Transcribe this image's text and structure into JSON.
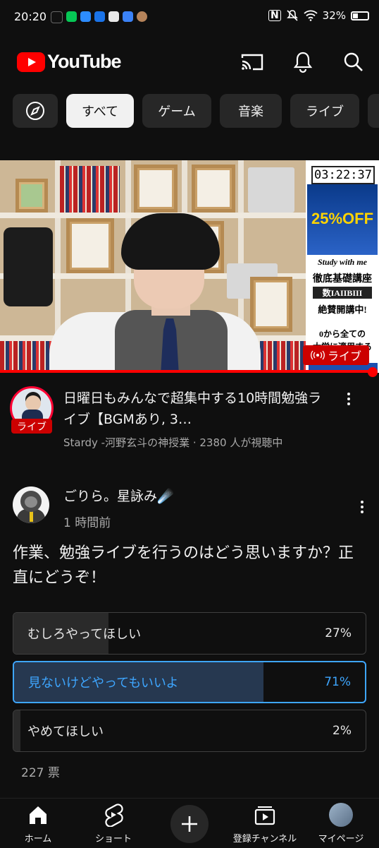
{
  "status_bar": {
    "time": "20:20",
    "battery": "32%"
  },
  "header": {
    "logo_text": "YouTube",
    "brand_color": "#ff0000"
  },
  "chips": [
    {
      "label": "すべて",
      "active": true
    },
    {
      "label": "ゲーム",
      "active": false
    },
    {
      "label": "音楽",
      "active": false
    },
    {
      "label": "ライブ",
      "active": false
    }
  ],
  "video": {
    "timer": "03:22:37",
    "ad_discount": "25%OFF",
    "ad_study": "Study with me",
    "ad_course": "徹底基礎講座",
    "ad_subject": "数IAIIBIII",
    "ad_sale": "絶賛開講中!",
    "ad_note": "0から全ての",
    "ad_note2": "大学に適用する",
    "live_badge": "ライブ",
    "channel_live_label": "ライブ",
    "title": "日曜日もみんなで超集中する10時間勉強ライブ【BGMあり, 3…",
    "meta": "Stardy -河野玄斗の神授業 · 2380 人が視聴中"
  },
  "post": {
    "author": "ごりら。星詠み☄️",
    "time": "1 時間前",
    "text": "作業、勉強ライブを行うのはどう思いますか？正直にどうぞ！",
    "poll": [
      {
        "label": "むしろやってほしい",
        "percent_text": "27%",
        "percent": 27,
        "selected": false
      },
      {
        "label": "見ないけどやってもいいよ",
        "percent_text": "71%",
        "percent": 71,
        "selected": true
      },
      {
        "label": "やめてほしい",
        "percent_text": "2%",
        "percent": 2,
        "selected": false
      }
    ],
    "votes": "227 票"
  },
  "bottom_nav": {
    "home": "ホーム",
    "shorts": "ショート",
    "subscriptions": "登録チャンネル",
    "mypage": "マイページ"
  },
  "colors": {
    "accent_blue": "#3ea6ff",
    "live_red": "#cc0000"
  }
}
